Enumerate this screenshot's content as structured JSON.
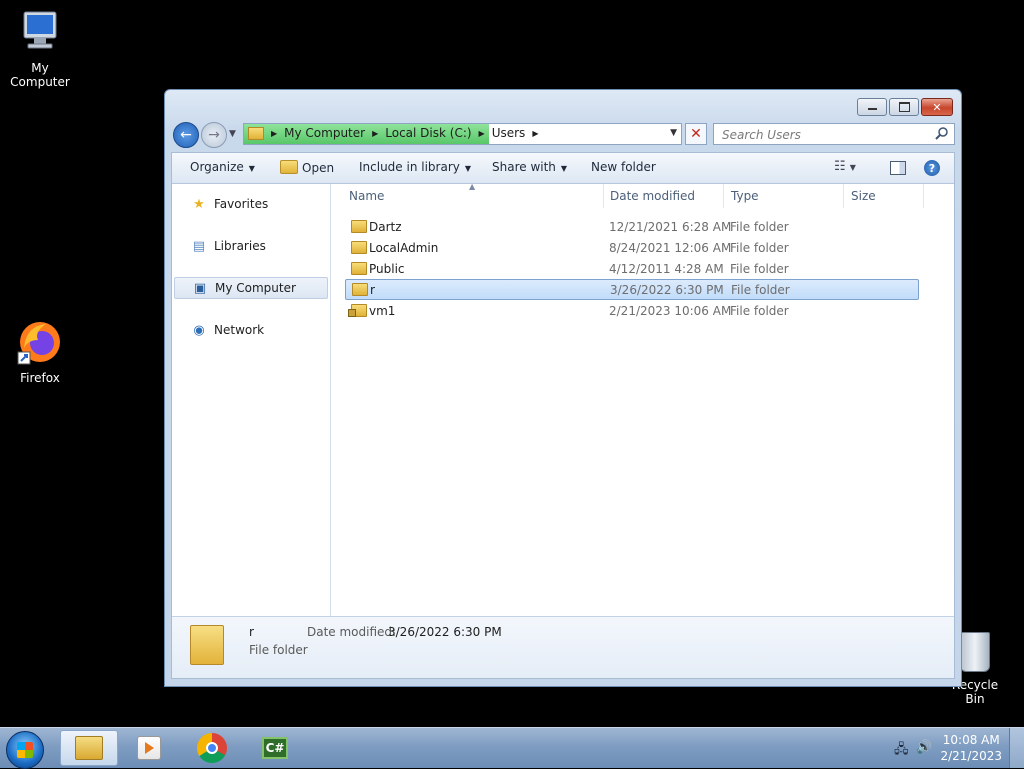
{
  "desktop": {
    "icons": [
      {
        "label": "My Computer"
      },
      {
        "label": "Firefox"
      },
      {
        "label": "Recycle Bin"
      }
    ]
  },
  "window": {
    "breadcrumb": [
      "My Computer",
      "Local Disk (C:)",
      "Users"
    ],
    "search_placeholder": "Search Users",
    "address_load_progress": 0.56,
    "toolbar": {
      "organize": "Organize",
      "open": "Open",
      "include": "Include in library",
      "share": "Share with",
      "new_folder": "New folder"
    },
    "nav": {
      "favorites": "Favorites",
      "libraries": "Libraries",
      "computer": "My Computer",
      "network": "Network"
    },
    "columns": {
      "name": "Name",
      "date": "Date modified",
      "type": "Type",
      "size": "Size"
    },
    "files": [
      {
        "name": "Dartz",
        "date": "12/21/2021 6:28 AM",
        "type": "File folder"
      },
      {
        "name": "LocalAdmin",
        "date": "8/24/2021 12:06 AM",
        "type": "File folder"
      },
      {
        "name": "Public",
        "date": "4/12/2011 4:28 AM",
        "type": "File folder"
      },
      {
        "name": "r",
        "date": "3/26/2022 6:30 PM",
        "type": "File folder"
      },
      {
        "name": "vm1",
        "date": "2/21/2023 10:06 AM",
        "type": "File folder"
      }
    ],
    "details": {
      "name": "r",
      "type": "File folder",
      "date_label": "Date modified:",
      "date_value": "3/26/2022 6:30 PM"
    }
  },
  "taskbar": {
    "apps": [
      "Windows Explorer",
      "Windows Media Player",
      "Google Chrome",
      "C# IDE"
    ],
    "time": "10:08 AM",
    "date": "2/21/2023",
    "icons": [
      "network-icon",
      "volume-icon"
    ]
  },
  "colors": {
    "selection": "#c1dcfa",
    "desktop": "#000000",
    "taskbar": "#7f9dc2"
  }
}
